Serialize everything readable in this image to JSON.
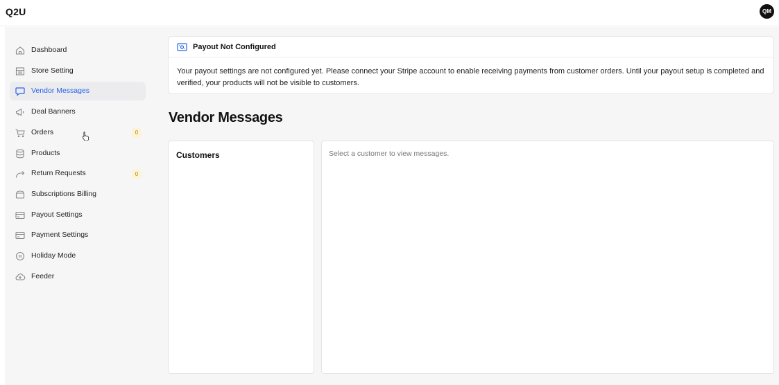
{
  "app": {
    "brand": "Q2U",
    "avatar_initials": "QM"
  },
  "sidebar": {
    "items": [
      {
        "label": "Dashboard",
        "icon": "home-icon",
        "active": false,
        "badge": null
      },
      {
        "label": "Store Setting",
        "icon": "store-icon",
        "active": false,
        "badge": null
      },
      {
        "label": "Vendor Messages",
        "icon": "chat-icon",
        "active": true,
        "badge": null
      },
      {
        "label": "Deal Banners",
        "icon": "megaphone-icon",
        "active": false,
        "badge": null
      },
      {
        "label": "Orders",
        "icon": "cart-icon",
        "active": false,
        "badge": "0"
      },
      {
        "label": "Products",
        "icon": "database-icon",
        "active": false,
        "badge": null
      },
      {
        "label": "Return Requests",
        "icon": "return-arrow-icon",
        "active": false,
        "badge": "0"
      },
      {
        "label": "Subscriptions Billing",
        "icon": "wallet-icon",
        "active": false,
        "badge": null
      },
      {
        "label": "Payout Settings",
        "icon": "card-icon",
        "active": false,
        "badge": null
      },
      {
        "label": "Payment Settings",
        "icon": "card-icon",
        "active": false,
        "badge": null
      },
      {
        "label": "Holiday Mode",
        "icon": "pause-icon",
        "active": false,
        "badge": null
      },
      {
        "label": "Feeder",
        "icon": "cloud-upload-icon",
        "active": false,
        "badge": null
      }
    ]
  },
  "alert": {
    "icon": "money-icon",
    "title": "Payout Not Configured",
    "message": "Your payout settings are not configured yet. Please connect your Stripe account to enable receiving payments from customer orders. Until your payout setup is completed and verified, your products will not be visible to customers."
  },
  "page": {
    "title": "Vendor Messages"
  },
  "customers_panel": {
    "title": "Customers"
  },
  "messages_panel": {
    "empty_text": "Select a customer to view messages."
  },
  "colors": {
    "accent": "#2563eb",
    "badge_bg": "#fdf3d6",
    "badge_text": "#b08a1a",
    "canvas_bg": "#f6f6f7"
  }
}
